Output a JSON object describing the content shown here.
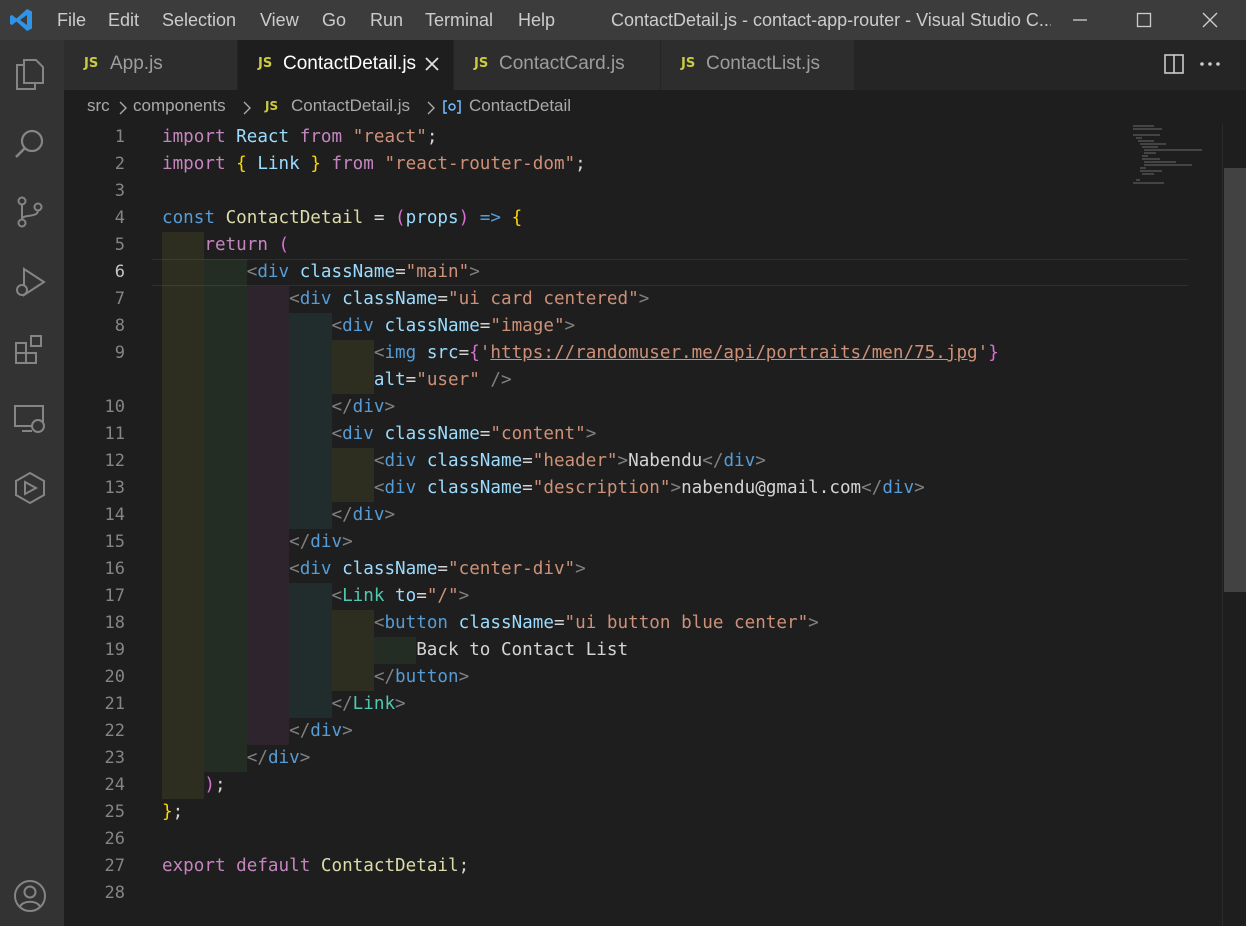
{
  "app": {
    "window_title": "ContactDetail.js - contact-app-router - Visual Studio C...",
    "menu": [
      "File",
      "Edit",
      "Selection",
      "View",
      "Go",
      "Run",
      "Terminal",
      "Help"
    ]
  },
  "activity_bar": [
    "explorer-icon",
    "search-icon",
    "source-control-icon",
    "run-debug-icon",
    "extensions-icon",
    "remote-explorer-icon",
    "deploy-icon",
    "account-icon"
  ],
  "tabs": [
    {
      "badge": "JS",
      "label": "App.js",
      "active": false
    },
    {
      "badge": "JS",
      "label": "ContactDetail.js",
      "active": true
    },
    {
      "badge": "JS",
      "label": "ContactCard.js",
      "active": false
    },
    {
      "badge": "JS",
      "label": "ContactList.js",
      "active": false
    }
  ],
  "breadcrumb": {
    "items": [
      "src",
      "components",
      "ContactDetail.js",
      "ContactDetail"
    ],
    "file_badge": "JS"
  },
  "editor": {
    "current_line": 6,
    "lines": [
      {
        "n": "1",
        "text": "import React from \"react\";"
      },
      {
        "n": "2",
        "text": "import { Link } from \"react-router-dom\";"
      },
      {
        "n": "3",
        "text": ""
      },
      {
        "n": "4",
        "text": "const ContactDetail = (props) => {"
      },
      {
        "n": "5",
        "text": "    return ("
      },
      {
        "n": "6",
        "text": "        <div className=\"main\">"
      },
      {
        "n": "7",
        "text": "            <div className=\"ui card centered\">"
      },
      {
        "n": "8",
        "text": "                <div className=\"image\">"
      },
      {
        "n": "9",
        "text": "                    <img src={'https://randomuser.me/api/portraits/men/75.jpg'}"
      },
      {
        "n": "",
        "text": "                    alt=\"user\" />"
      },
      {
        "n": "10",
        "text": "                </div>"
      },
      {
        "n": "11",
        "text": "                <div className=\"content\">"
      },
      {
        "n": "12",
        "text": "                    <div className=\"header\">Nabendu</div>"
      },
      {
        "n": "13",
        "text": "                    <div className=\"description\">nabendu@gmail.com</div>"
      },
      {
        "n": "14",
        "text": "                </div>"
      },
      {
        "n": "15",
        "text": "            </div>"
      },
      {
        "n": "16",
        "text": "            <div className=\"center-div\">"
      },
      {
        "n": "17",
        "text": "                <Link to=\"/\">"
      },
      {
        "n": "18",
        "text": "                    <button className=\"ui button blue center\">"
      },
      {
        "n": "19",
        "text": "                        Back to Contact List"
      },
      {
        "n": "20",
        "text": "                    </button>"
      },
      {
        "n": "21",
        "text": "                </Link>"
      },
      {
        "n": "22",
        "text": "            </div>"
      },
      {
        "n": "23",
        "text": "        </div>"
      },
      {
        "n": "24",
        "text": "    );"
      },
      {
        "n": "25",
        "text": "};"
      },
      {
        "n": "26",
        "text": ""
      },
      {
        "n": "27",
        "text": "export default ContactDetail;"
      },
      {
        "n": "28",
        "text": ""
      }
    ]
  },
  "colors": {
    "keyword": "#c586c0",
    "variable": "#9cdcfe",
    "string": "#ce9178",
    "function": "#dcdcaa",
    "declaration": "#569cd6",
    "component": "#4ec9b0",
    "bracket_gold": "#ffd700",
    "bracket_orchid": "#da70d6",
    "bracket_blue": "#179fff",
    "js_badge": "#cbcb41"
  }
}
